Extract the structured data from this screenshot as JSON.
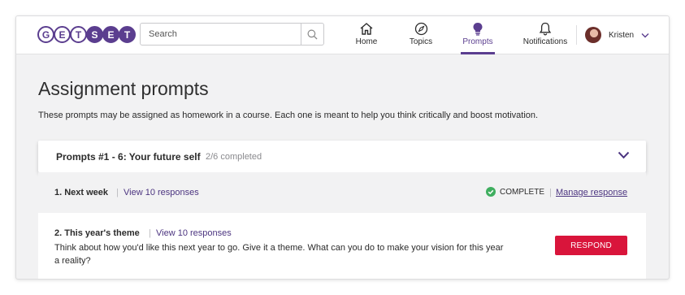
{
  "colors": {
    "brand": "#5b3e8f",
    "link": "#4c3580",
    "respond": "#d9153b",
    "complete": "#3fae5f"
  },
  "logo": {
    "letters": [
      "G",
      "E",
      "T",
      "S",
      "E",
      "T"
    ],
    "text": "GETSET"
  },
  "search": {
    "placeholder": "Search",
    "icon": "search-icon"
  },
  "nav": {
    "items": [
      {
        "label": "Home",
        "icon": "home-icon",
        "active": false
      },
      {
        "label": "Topics",
        "icon": "compass-icon",
        "active": false
      },
      {
        "label": "Prompts",
        "icon": "lightbulb-icon",
        "active": true
      },
      {
        "label": "Notifications",
        "icon": "bell-icon",
        "active": false
      }
    ]
  },
  "user": {
    "name": "Kristen",
    "menu_icon": "chevron-down-icon"
  },
  "page": {
    "title": "Assignment prompts",
    "description": "These prompts may be assigned as homework in a course. Each one is meant to help you think critically and boost motivation."
  },
  "group": {
    "title": "Prompts #1 - 6: Your future self",
    "progress": "2/6 completed",
    "toggle_icon": "chevron-down-icon"
  },
  "prompts": [
    {
      "title": "1. Next week",
      "responses_link": "View 10 responses",
      "status": "COMPLETE",
      "status_icon": "check-circle-icon",
      "action": "Manage response"
    },
    {
      "title": "2. This year's theme",
      "responses_link": "View 10 responses",
      "body": "Think about how you'd like this next year to go. Give it a theme. What can you do to make your vision for this year a reality?",
      "action": "RESPOND"
    }
  ]
}
